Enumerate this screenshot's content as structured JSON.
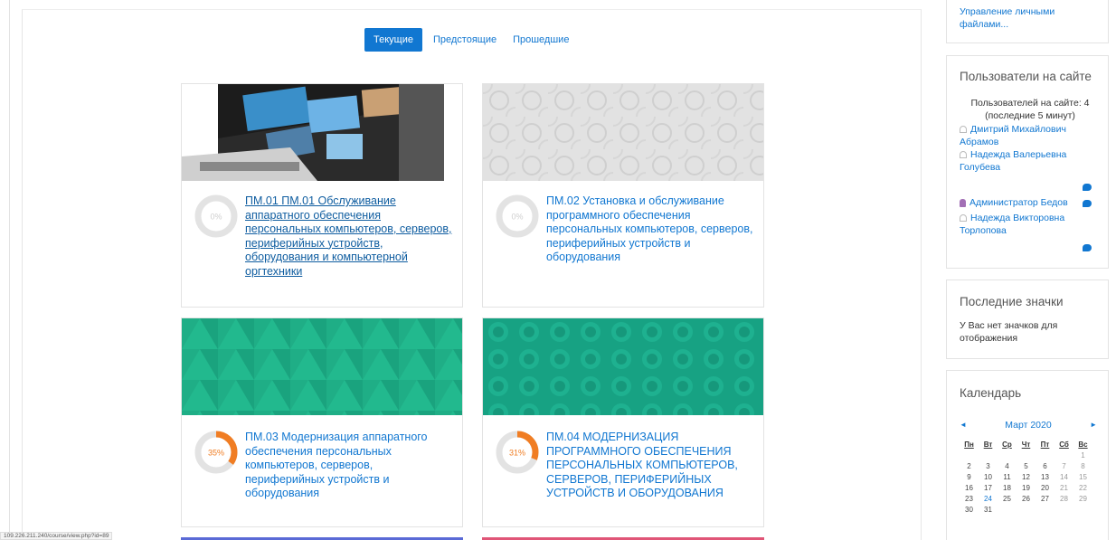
{
  "tabs": [
    {
      "label": "Текущие",
      "active": true
    },
    {
      "label": "Предстоящие",
      "active": false
    },
    {
      "label": "Прошедшие",
      "active": false
    }
  ],
  "courses": [
    {
      "title": "ПМ.01 ПМ.01 Обслуживание аппаратного обеспечения персональных компьютеров, серверов, периферийных устройств, оборудования и компьютерной оргтехники",
      "progress_label": "0%",
      "progress": 0
    },
    {
      "title": "ПМ.02 Установка и обслуживание программного обеспечения персональных компьютеров, серверов, периферийных устройств и оборудования",
      "progress_label": "0%",
      "progress": 0
    },
    {
      "title": "ПМ.03 Модернизация аппаратного обеспечения персональных компьютеров, серверов, периферийных устройств и оборудования",
      "progress_label": "35%",
      "progress": 35
    },
    {
      "title": "ПМ.04 МОДЕРНИЗАЦИЯ ПРОГРАММНОГО ОБЕСПЕЧЕНИЯ ПЕРСОНАЛЬНЫХ КОМПЬЮТЕРОВ, СЕРВЕРОВ, ПЕРИФЕРИЙНЫХ УСТРОЙСТВ И ОБОРУДОВАНИЯ",
      "progress_label": "31%",
      "progress": 31
    }
  ],
  "private_files": {
    "link": "Управление личными файлами..."
  },
  "online_users": {
    "title": "Пользователи на сайте",
    "summary": "Пользователей на сайте: 4 (последние 5 минут)",
    "users": [
      "Дмитрий Михайлович Абрамов",
      "Надежда Валерьевна Голубева",
      "Администратор Бедов",
      "Надежда Викторовна Торлопова"
    ]
  },
  "badges": {
    "title": "Последние значки",
    "text": "У Вас нет значков для отображения"
  },
  "calendar": {
    "title": "Календарь",
    "month": "Март 2020",
    "prev": "◄",
    "next": "►",
    "weekdays": [
      "Пн",
      "Вт",
      "Ср",
      "Чт",
      "Пт",
      "Сб",
      "Вс"
    ],
    "weeks": [
      [
        "",
        "",
        "",
        "",
        "",
        "",
        "1"
      ],
      [
        "2",
        "3",
        "4",
        "5",
        "6",
        "7",
        "8"
      ],
      [
        "9",
        "10",
        "11",
        "12",
        "13",
        "14",
        "15"
      ],
      [
        "16",
        "17",
        "18",
        "19",
        "20",
        "21",
        "22"
      ],
      [
        "23",
        "24",
        "25",
        "26",
        "27",
        "28",
        "29"
      ],
      [
        "30",
        "31",
        "",
        "",
        "",
        "",
        ""
      ]
    ]
  },
  "status_url": "109.226.211.240/course/view.php?id=89",
  "colors": {
    "accent": "#1177d1",
    "progress": "#f07d23",
    "ring": "#e3e3e3"
  }
}
